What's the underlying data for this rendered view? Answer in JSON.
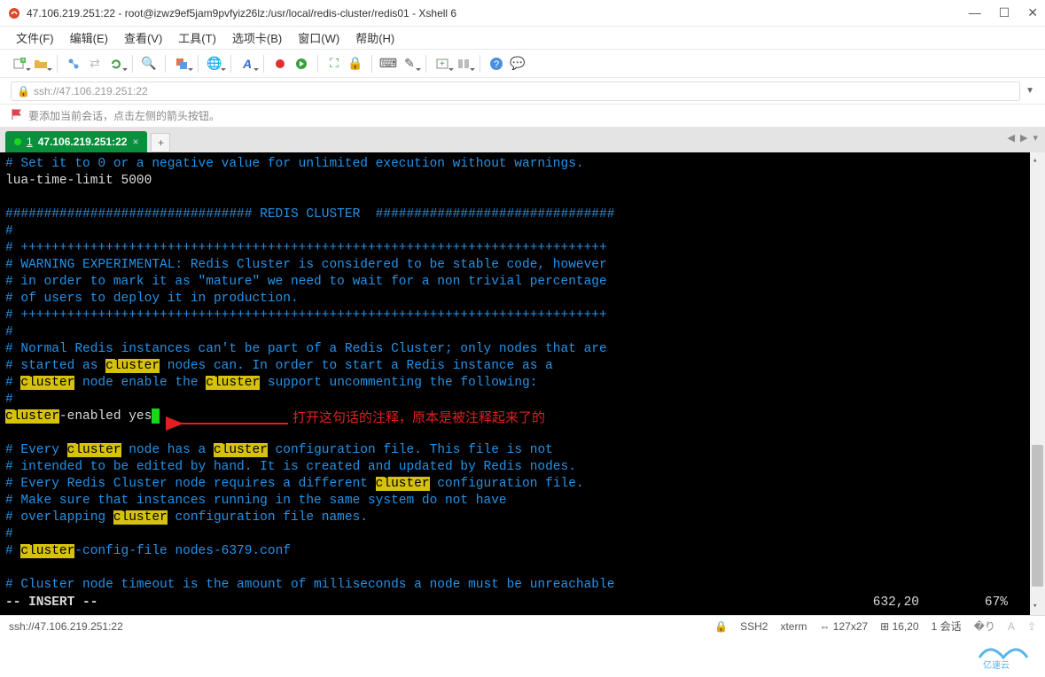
{
  "window": {
    "title": "47.106.219.251:22 - root@izwz9ef5jam9pvfyiz26lz:/usr/local/redis-cluster/redis01 - Xshell 6"
  },
  "menu": {
    "file": "文件(F)",
    "edit": "编辑(E)",
    "view": "查看(V)",
    "tools": "工具(T)",
    "tabs": "选项卡(B)",
    "window": "窗口(W)",
    "help": "帮助(H)"
  },
  "addressbar": {
    "url": "ssh://47.106.219.251:22"
  },
  "hint": {
    "text": "要添加当前会话，点击左侧的箭头按钮。"
  },
  "tab": {
    "index": "1",
    "label": "47.106.219.251:22",
    "add": "+"
  },
  "terminal": {
    "l0": "# Set it to 0 or a negative value for unlimited execution without warnings.",
    "l1": "lua-time-limit 5000",
    "l2": "",
    "l3": "################################ REDIS CLUSTER  ###############################",
    "l4": "#",
    "l5": "# ++++++++++++++++++++++++++++++++++++++++++++++++++++++++++++++++++++++++++++",
    "l6": "# WARNING EXPERIMENTAL: Redis Cluster is considered to be stable code, however",
    "l7": "# in order to mark it as \"mature\" we need to wait for a non trivial percentage",
    "l8": "# of users to deploy it in production.",
    "l9": "# ++++++++++++++++++++++++++++++++++++++++++++++++++++++++++++++++++++++++++++",
    "l10": "#",
    "l11": "# Normal Redis instances can't be part of a Redis Cluster; only nodes that are",
    "l12a": "# started as ",
    "l12b": " nodes can. In order to start a Redis instance as a",
    "l13a": "# ",
    "l13b": " node enable the ",
    "l13c": " support uncommenting the following:",
    "l14": "#",
    "l15a": "",
    "l15b": "-enabled yes",
    "l16": "",
    "l17a": "# Every ",
    "l17b": " node has a ",
    "l17c": " configuration file. This file is not",
    "l18": "# intended to be edited by hand. It is created and updated by Redis nodes.",
    "l19a": "# Every Redis Cluster node requires a different ",
    "l19b": " configuration file.",
    "l20": "# Make sure that instances running in the same system do not have",
    "l21a": "# overlapping ",
    "l21b": " configuration file names.",
    "l22": "#",
    "l23a": "# ",
    "l23b": "-config-file nodes-6379.conf",
    "l24": "",
    "l25": "# Cluster node timeout is the amount of milliseconds a node must be unreachable",
    "hl": "cluster",
    "vim_mode": "-- INSERT --",
    "vim_pos": "632,20",
    "vim_pct": "67%",
    "annotation": "打开这句话的注释，原本是被注释起来了的"
  },
  "status": {
    "addr": "ssh://47.106.219.251:22",
    "ssh": "SSH2",
    "term": "xterm",
    "size": "127x27",
    "cursor": "16,20",
    "sessions": "1 会话"
  }
}
